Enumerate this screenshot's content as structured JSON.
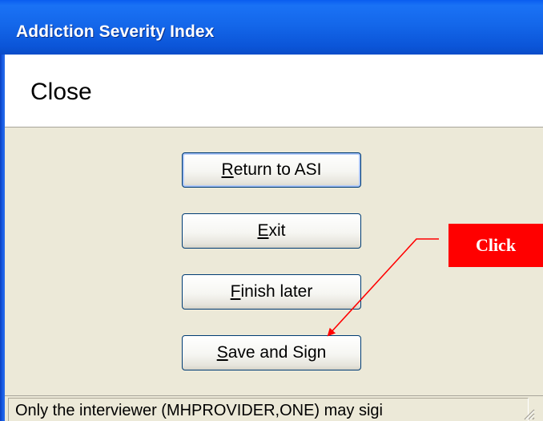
{
  "window": {
    "title": "Addiction Severity Index"
  },
  "header": {
    "title": "Close"
  },
  "buttons": [
    {
      "name": "return-to-asi-button",
      "accel": "R",
      "rest": "eturn to ASI"
    },
    {
      "name": "exit-button",
      "accel": "E",
      "rest": "xit"
    },
    {
      "name": "finish-later-button",
      "accel": "F",
      "rest": "inish later"
    },
    {
      "name": "save-and-sign-button",
      "accel": "S",
      "rest": "ave and Sign"
    }
  ],
  "status": {
    "text": "Only the interviewer (MHPROVIDER,ONE) may sigi"
  },
  "callout": {
    "label": "Click",
    "color": "#ff0000"
  },
  "colors": {
    "titlebar": "#0b55d8",
    "dialog_bg": "#ece9d8",
    "button_border": "#003c74"
  }
}
